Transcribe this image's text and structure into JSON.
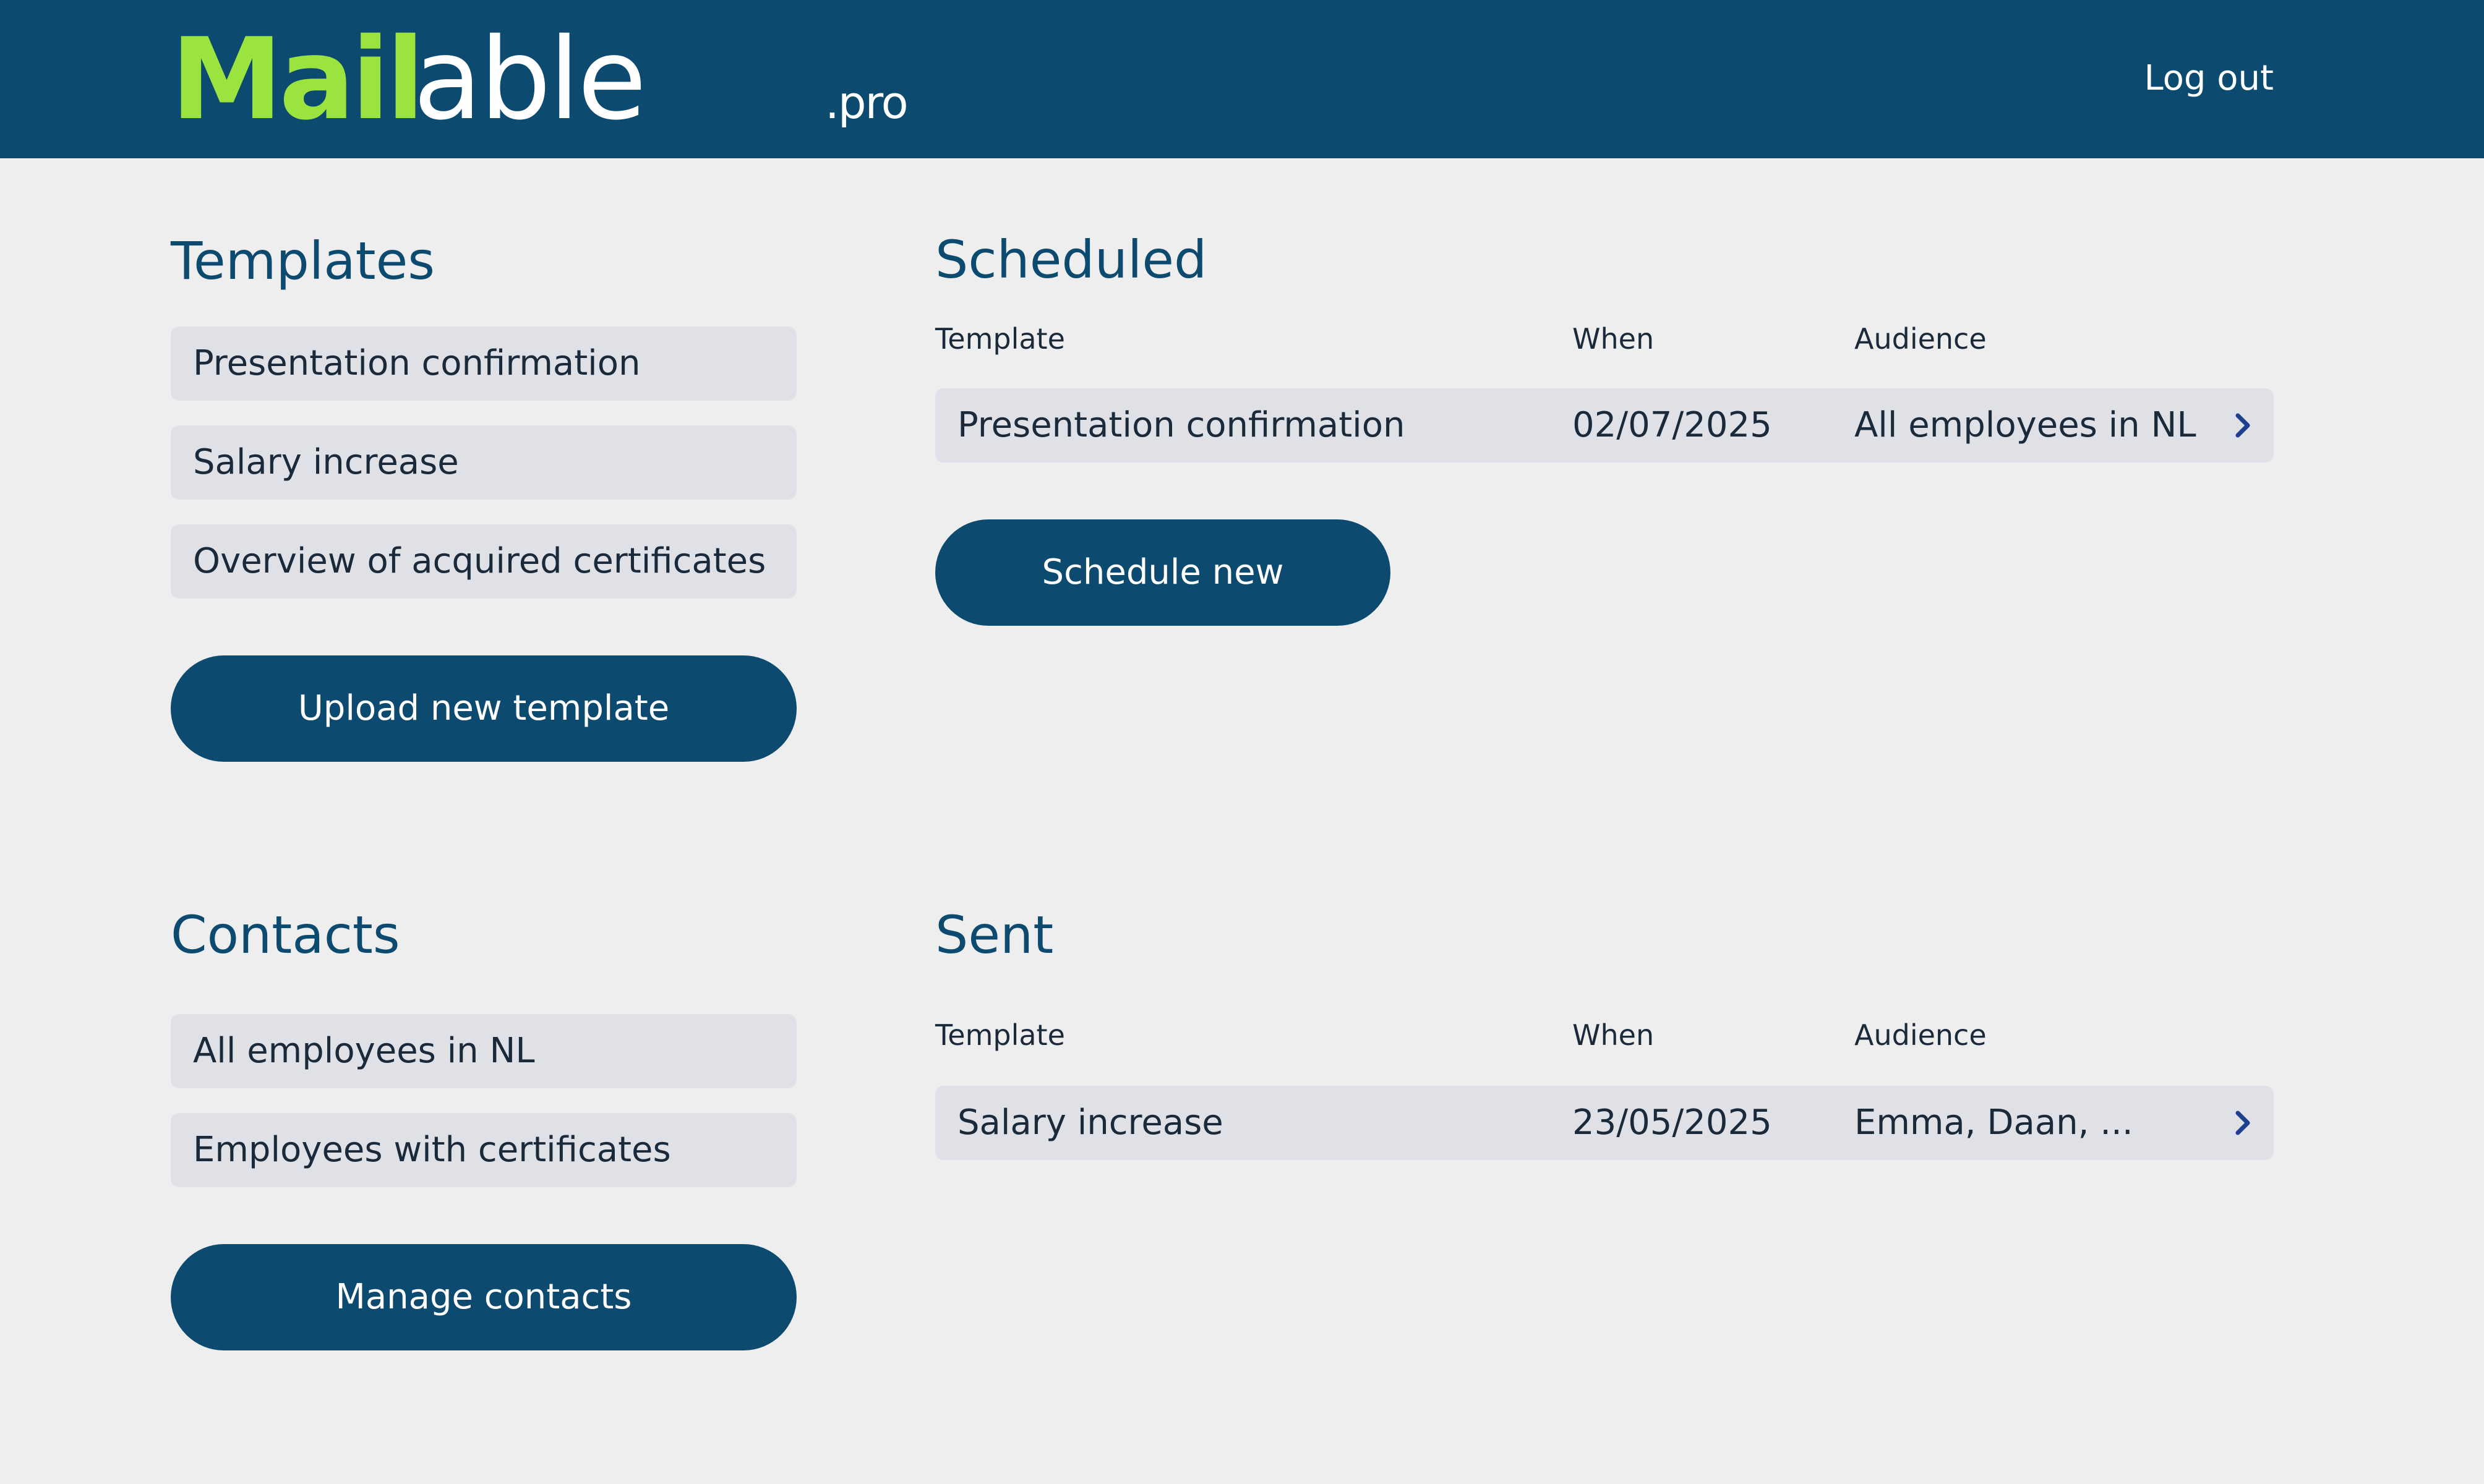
{
  "header": {
    "logo_mail": "Mail",
    "logo_able": "able",
    "logo_suffix": ".pro",
    "logout_label": "Log out"
  },
  "templates": {
    "title": "Templates",
    "items": [
      "Presentation confirmation",
      "Salary increase",
      "Overview of acquired certificates"
    ],
    "upload_label": "Upload new template"
  },
  "contacts": {
    "title": "Contacts",
    "items": [
      "All employees in NL",
      "Employees with certificates"
    ],
    "manage_label": "Manage contacts"
  },
  "scheduled": {
    "title": "Scheduled",
    "columns": [
      "Template",
      "When",
      "Audience"
    ],
    "rows": [
      {
        "template": "Presentation confirmation",
        "when": "02/07/2025",
        "audience": "All employees in NL"
      }
    ],
    "schedule_label": "Schedule new"
  },
  "sent": {
    "title": "Sent",
    "columns": [
      "Template",
      "When",
      "Audience"
    ],
    "rows": [
      {
        "template": "Salary increase",
        "when": "23/05/2025",
        "audience": "Emma, Daan, ..."
      }
    ]
  },
  "colors": {
    "header_bg": "#0d4a6f",
    "logo_accent": "#9be33f",
    "page_bg": "#eeeeee",
    "pill_bg": "#dfe1e7",
    "chevron": "#1f3f8f"
  },
  "icons": {
    "row_chevron": "chevron-right-icon"
  }
}
